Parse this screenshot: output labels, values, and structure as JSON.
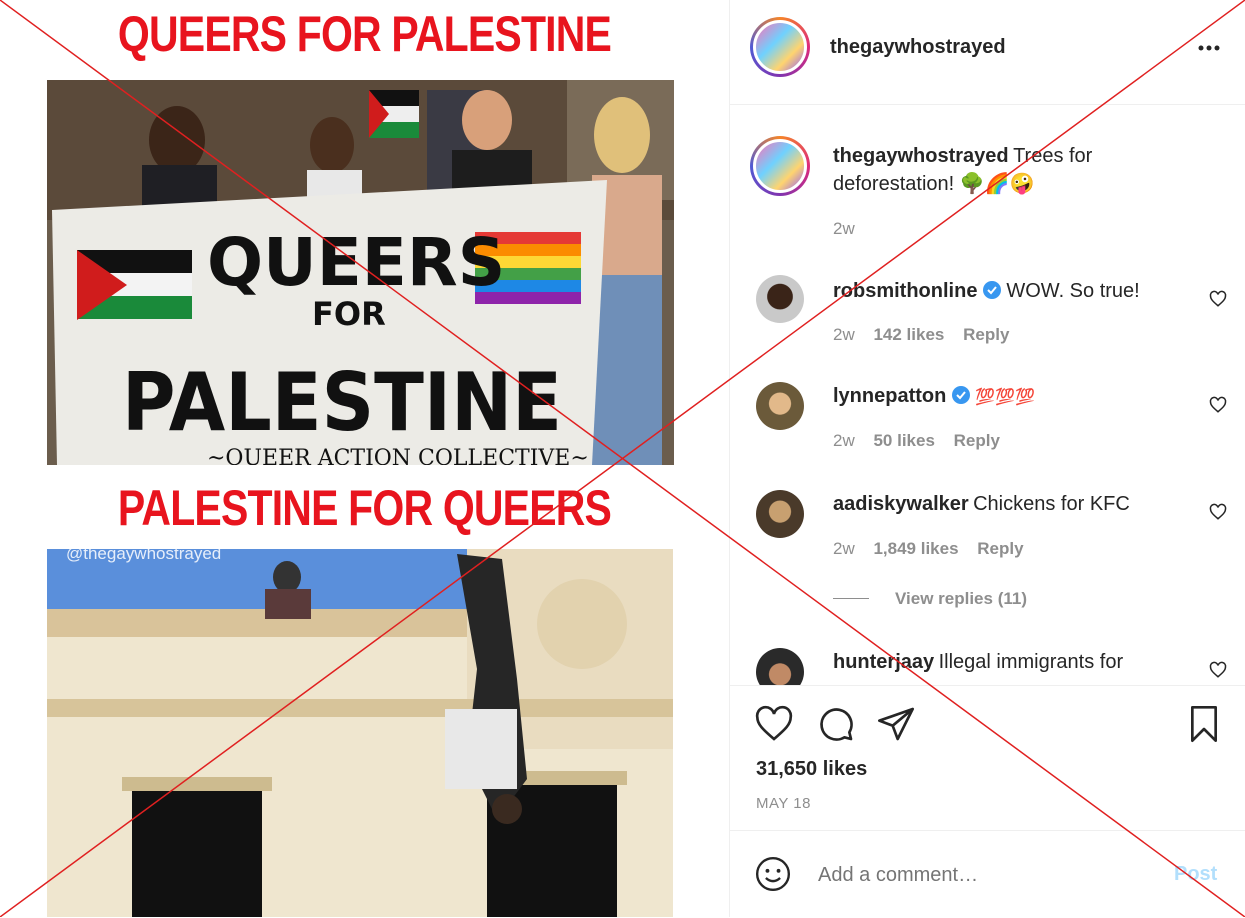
{
  "meme": {
    "title_top": "QUEERS FOR PALESTINE",
    "title_bottom": "PALESTINE FOR QUEERS",
    "banner_line1": "QUEERS",
    "banner_line2": "FOR",
    "banner_line3": "PALESTINE",
    "banner_line4": "~QUEER ACTION COLLECTIVE~",
    "watermark": "@thegaywhostrayed"
  },
  "post": {
    "author": "thegaywhostrayed",
    "more_icon": "more-horizontal-icon",
    "caption_user": "thegaywhostrayed",
    "caption_text": "Trees for deforestation! 🌳🌈🤪",
    "caption_time": "2w"
  },
  "comments": [
    {
      "user": "robsmithonline",
      "verified": true,
      "text": "WOW. So true!",
      "time": "2w",
      "likes": "142 likes",
      "reply": "Reply"
    },
    {
      "user": "lynnepatton",
      "verified": true,
      "text": "💯💯💯",
      "time": "2w",
      "likes": "50 likes",
      "reply": "Reply"
    },
    {
      "user": "aadiskywalker",
      "verified": false,
      "text": "Chickens for KFC",
      "time": "2w",
      "likes": "1,849 likes",
      "reply": "Reply"
    },
    {
      "user": "hunterjaay",
      "verified": false,
      "text": "Illegal immigrants for",
      "time": "",
      "likes": "",
      "reply": ""
    }
  ],
  "view_replies": "View replies (11)",
  "likes_count": "31,650 likes",
  "post_date": "MAY 18",
  "add_comment": {
    "placeholder": "Add a comment…",
    "post_label": "Post"
  },
  "colors": {
    "meme_red": "#e8141e",
    "verified_blue": "#3897f0",
    "cross_line": "#e02020",
    "muted": "#8e8e8e"
  }
}
